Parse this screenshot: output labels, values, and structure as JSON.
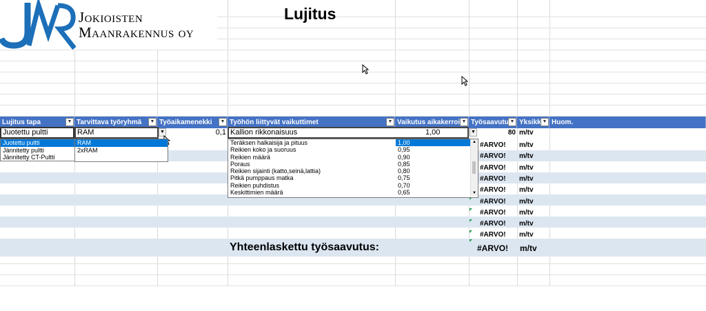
{
  "logo": {
    "line1": "Jokioisten",
    "line2": "Maanrakennus oy"
  },
  "sheet_title": "Lujitus",
  "headers": [
    "Lujitus tapa",
    "Tarvittava työryhmä",
    "Työaikamenekki",
    "Työhön liittyvät vaikuttimet",
    "Vaikutus aikakerroin",
    "Työsaavutus",
    "Yksikkö",
    "Huom."
  ],
  "row1": {
    "lujitus_tapa": "Juotettu pultti",
    "tyoryhma": "RAM",
    "tyoaika": "0,1",
    "vaikuttimet": "Kallion rikkonaisuus",
    "aikakerroin": "1,00",
    "tyosaavutus": "80",
    "yksikko": "m/tv"
  },
  "lujitus_options": [
    "Juotettu pultti",
    "Jännitetty pultti",
    "Jännitetty CT-Pultti"
  ],
  "tyoryhma_options": [
    "RAM",
    "2xRAM"
  ],
  "vaikuttimet_list": [
    {
      "name": "Teräksen halkaisija ja pituus",
      "value": "1,00"
    },
    {
      "name": "Reikien koko ja suoruus",
      "value": "0,95"
    },
    {
      "name": "Reikien määrä",
      "value": "0,90"
    },
    {
      "name": "Poraus",
      "value": "0,85"
    },
    {
      "name": "Reikien sijainti (katto,seinä,lattia)",
      "value": "0,80"
    },
    {
      "name": "Pitkä pumppaus matka",
      "value": "0,75"
    },
    {
      "name": "Reikien puhdistus",
      "value": "0,70"
    },
    {
      "name": "Keskittimien määrä",
      "value": "0,65"
    }
  ],
  "error_rows": [
    {
      "tyosaavutus": "#ARVO!",
      "yksikko": "m/tv"
    },
    {
      "tyosaavutus": "#ARVO!",
      "yksikko": "m/tv"
    },
    {
      "tyosaavutus": "#ARVO!",
      "yksikko": "m/tv"
    },
    {
      "tyosaavutus": "#ARVO!",
      "yksikko": "m/tv"
    },
    {
      "tyosaavutus": "#ARVO!",
      "yksikko": "m/tv"
    },
    {
      "tyosaavutus": "#ARVO!",
      "yksikko": "m/tv"
    },
    {
      "tyosaavutus": "#ARVO!",
      "yksikko": "m/tv"
    },
    {
      "tyosaavutus": "#ARVO!",
      "yksikko": "m/tv"
    },
    {
      "tyosaavutus": "#ARVO!",
      "yksikko": "m/tv"
    }
  ],
  "total": {
    "label": "Yhteenlaskettu työsaavutus:",
    "value": "#ARVO!",
    "unit": "m/tv"
  },
  "colors": {
    "header": "#4472c4",
    "band": "#dce6f1",
    "selection": "#0078d7",
    "logo": "#1c6fb8"
  }
}
